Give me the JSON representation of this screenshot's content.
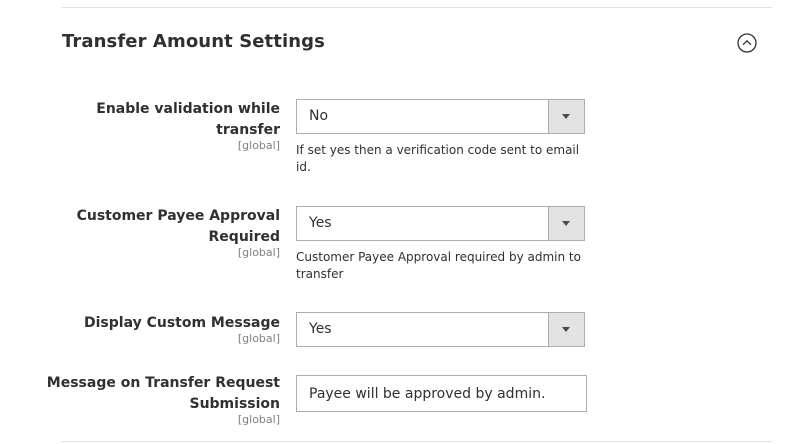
{
  "section": {
    "title": "Transfer Amount Settings",
    "toggle_icon": "chevron-up-circle-icon"
  },
  "fields": [
    {
      "label_line1": "Enable validation while",
      "label_line2": "transfer",
      "scope": "[global]",
      "value": "No",
      "note_line1": "If set yes then a verification code sent to email",
      "note_line2": "id."
    },
    {
      "label_line1": "Customer Payee Approval",
      "label_line2": "Required",
      "scope": "[global]",
      "value": "Yes",
      "note_line1": "Customer Payee Approval required by admin to",
      "note_line2": "transfer"
    },
    {
      "label": "Display Custom Message",
      "scope": "[global]",
      "value": "Yes"
    },
    {
      "label_line1": "Message on Transfer Request",
      "label_line2": "Submission",
      "scope": "[global]",
      "value": "Payee will be approved by admin."
    }
  ],
  "colors": {
    "text": "#303030",
    "scope_text": "#808080",
    "border": "#adadad",
    "select_button_bg": "#e3e3e3",
    "divider": "#e3e3e3"
  }
}
